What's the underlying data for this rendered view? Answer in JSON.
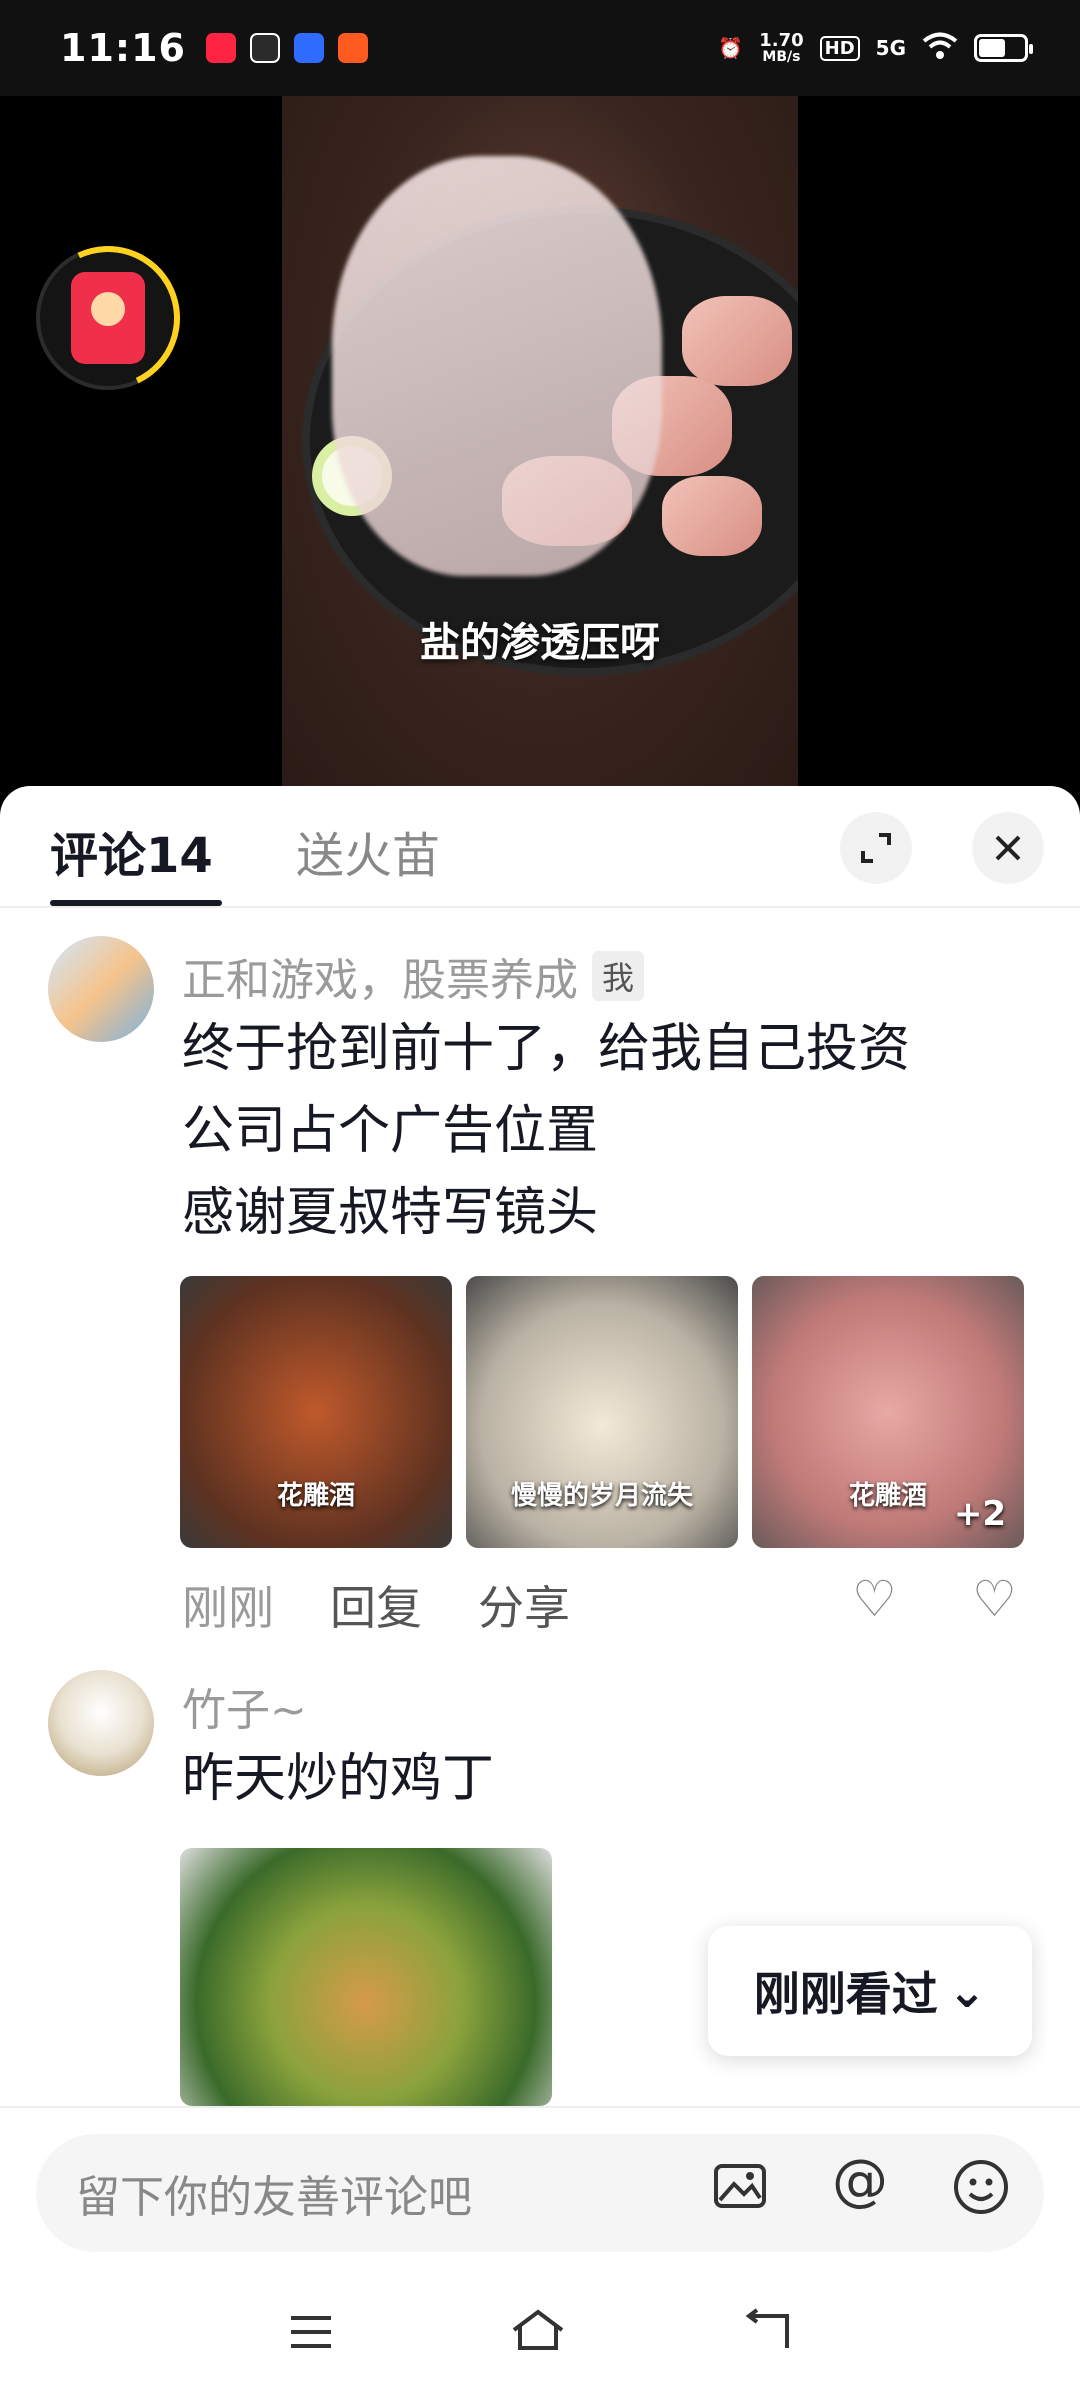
{
  "status_bar": {
    "time": "11:16",
    "app_icons": [
      "xiaohongshu-app-icon",
      "app-icon-2",
      "baidu-app-icon",
      "app-icon-4"
    ],
    "net_speed_value": "1.70",
    "net_speed_unit": "MB/s",
    "hd_label": "HD",
    "signal_label": "5G"
  },
  "video": {
    "subtitle": "盐的渗透压呀"
  },
  "sheet": {
    "tabs": [
      {
        "label": "评论14"
      },
      {
        "label": "送火苗"
      }
    ],
    "expand_icon": "expand-icon",
    "close_icon": "close-icon"
  },
  "comments": [
    {
      "username": "正和游戏，股票养成",
      "badge": "我",
      "text_lines": [
        "终于抢到前十了，给我自己投资",
        "公司占个广告位置",
        "感谢夏叔特写镜头"
      ],
      "thumbnails": [
        {
          "caption": "花雕酒",
          "color": "#8a4a2c"
        },
        {
          "caption": "慢慢的岁月流失",
          "color": "#c9c1b5"
        },
        {
          "caption": "花雕酒",
          "color": "#c98a88",
          "more": "+2"
        }
      ],
      "time": "刚刚",
      "reply_label": "回复",
      "share_label": "分享"
    },
    {
      "username": "竹子~",
      "text_lines": [
        "昨天炒的鸡丁"
      ]
    }
  ],
  "seen_button": {
    "label": "刚刚看过"
  },
  "input": {
    "placeholder": "留下你的友善评论吧"
  },
  "colors": {
    "accent_red": "#f0304a",
    "ring_yellow": "#ffd21f",
    "text_primary": "#161823",
    "text_secondary": "#9a9a9a"
  }
}
